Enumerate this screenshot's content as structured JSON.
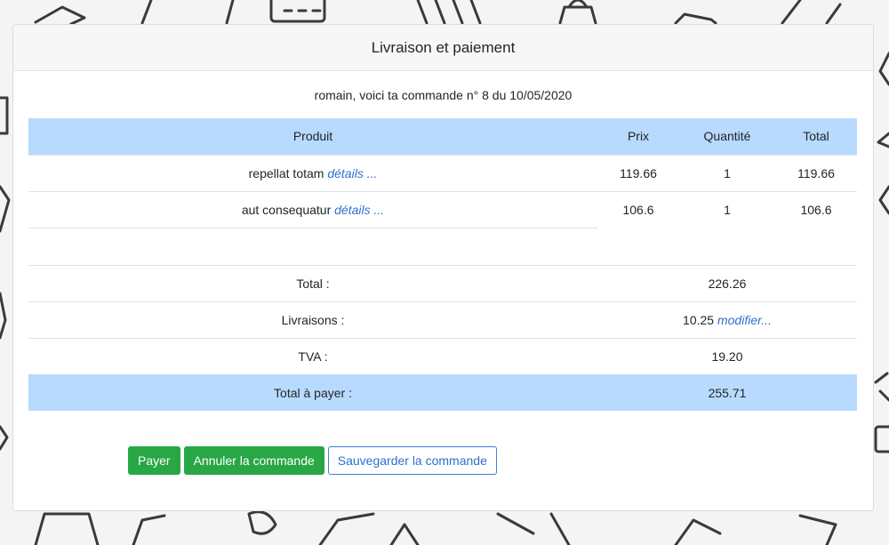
{
  "header": {
    "title": "Livraison et paiement"
  },
  "intro": "romain, voici ta commande n° 8 du 10/05/2020",
  "table": {
    "columns": [
      "Produit",
      "Prix",
      "Quantité",
      "Total"
    ],
    "details_label": "détails ...",
    "rows": [
      {
        "product": "repellat totam",
        "price": "119.66",
        "quantity": "1",
        "total": "119.66"
      },
      {
        "product": "aut consequatur",
        "price": "106.6",
        "quantity": "1",
        "total": "106.6"
      }
    ]
  },
  "summary": {
    "total_label": "Total :",
    "total_value": "226.26",
    "shipping_label": "Livraisons :",
    "shipping_value": "10.25",
    "shipping_modify": "modifier...",
    "tva_label": "TVA :",
    "tva_value": "19.20",
    "to_pay_label": "Total à payer :",
    "to_pay_value": "255.71"
  },
  "actions": {
    "pay": "Payer",
    "cancel": "Annuler la commande",
    "save": "Sauvegarder la commande"
  },
  "colors": {
    "table_header": "#b8daff",
    "success": "#28a745",
    "link": "#2f6fcd"
  }
}
